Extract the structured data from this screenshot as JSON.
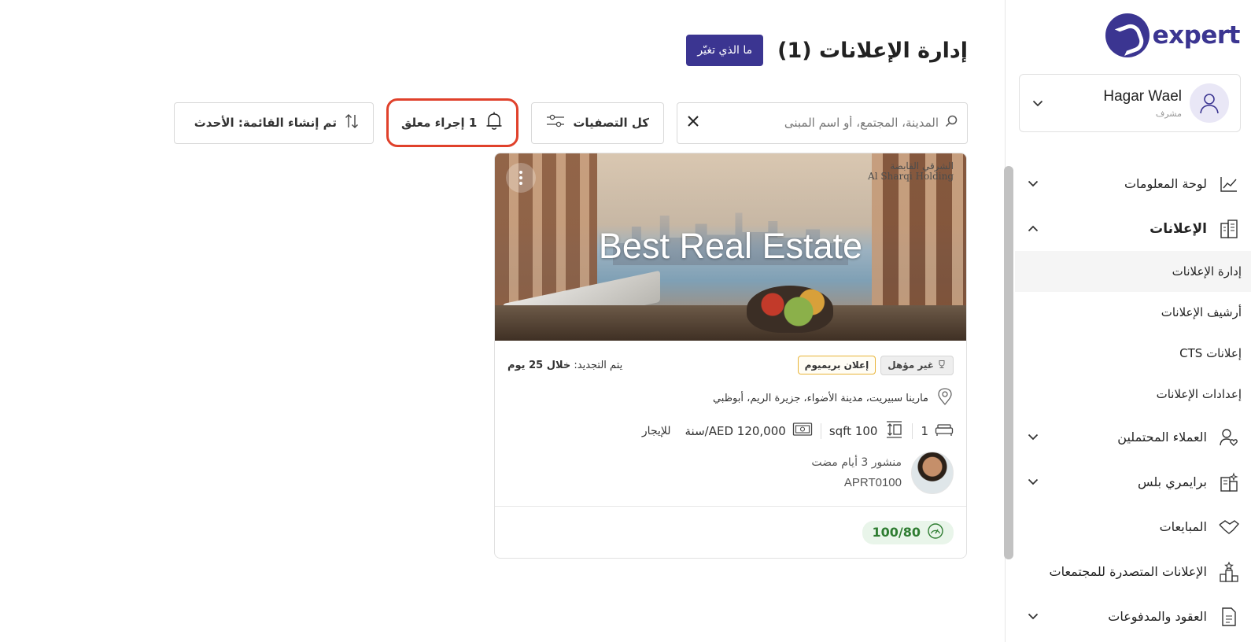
{
  "brand": {
    "logo_text": "expert"
  },
  "user": {
    "name": "Hagar Wael",
    "role": "مشرف"
  },
  "nav": {
    "dashboard": "لوحة المعلومات",
    "listings": "الإعلانات",
    "listings_sub": [
      "إدارة الإعلانات",
      "أرشيف الإعلانات",
      "إعلانات CTS",
      "إعدادات الإعلانات"
    ],
    "leads": "العملاء المحتملين",
    "primary_plus": "برايمري بلس",
    "deals": "المبايعات",
    "top_communities": "الإعلانات المتصدرة للمجتمعات",
    "contracts": "العقود والمدفوعات"
  },
  "page": {
    "title": "إدارة الإعلانات (1)",
    "whats_new": "ما الذي تغيّر"
  },
  "toolbar": {
    "search_placeholder": "المدينة، المجتمع، أو اسم المبنى",
    "filters_label": "كل التصفيات",
    "pending_label": "1 إجراء معلق",
    "sort_label": "تم إنشاء القائمة: الأحدث"
  },
  "listing": {
    "overlay_title": "Best Real Estate",
    "brand_watermark_ar": "الشرقي القابضة",
    "brand_watermark_en": "Al Sharqi Holding",
    "badge_not_eligible": "غير مؤهل",
    "badge_premium": "إعلان بريميوم",
    "renew_label": "يتم التجديد:",
    "renew_value": "خلال 25 يوم",
    "location": "مارينا سبيريت، مدينة الأضواء، جزيرة الريم، أبوظبي",
    "bedrooms": "1",
    "size": "sqft 100",
    "price": "AED 120,000/سنة",
    "purpose": "للإيجار",
    "published": "منشور 3 أيام مضت",
    "reference": "APRT0100",
    "quality_score": "100/80"
  },
  "colors": {
    "brand": "#3b3591",
    "alert": "#e0412b",
    "score_green": "#2f7d32"
  }
}
